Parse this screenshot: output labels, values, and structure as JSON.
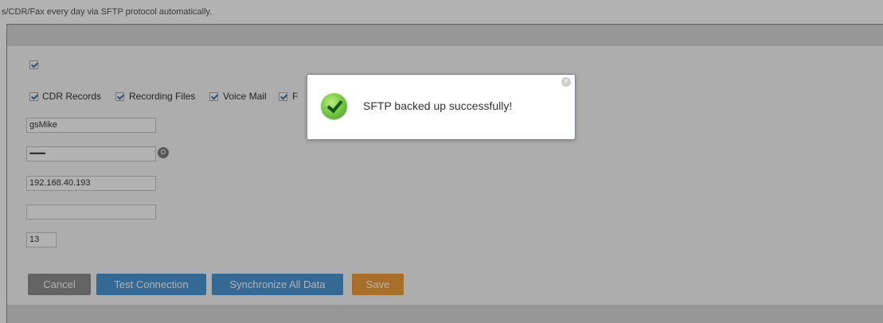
{
  "description": "s/CDR/Fax every day via SFTP protocol automatically.",
  "options": {
    "cdr_records": "CDR Records",
    "recording_files": "Recording Files",
    "voice_mail": "Voice Mail",
    "fax_truncated": "F"
  },
  "fields": {
    "username": "gsMike",
    "password": "•••••••••",
    "server_address": "192.168.40.193",
    "destination_directory": "",
    "backup_time": "13"
  },
  "buttons": {
    "cancel": "Cancel",
    "test_connection": "Test Connection",
    "synchronize_all_data": "Synchronize All Data",
    "save": "Save"
  },
  "dialog": {
    "message": "SFTP backed up successfully!",
    "close_glyph": "×"
  },
  "colors": {
    "primary_button": "#4b97d5",
    "save_button": "#f09f3c",
    "cancel_button": "#8e8e8e",
    "success_green": "#6cc43a"
  }
}
